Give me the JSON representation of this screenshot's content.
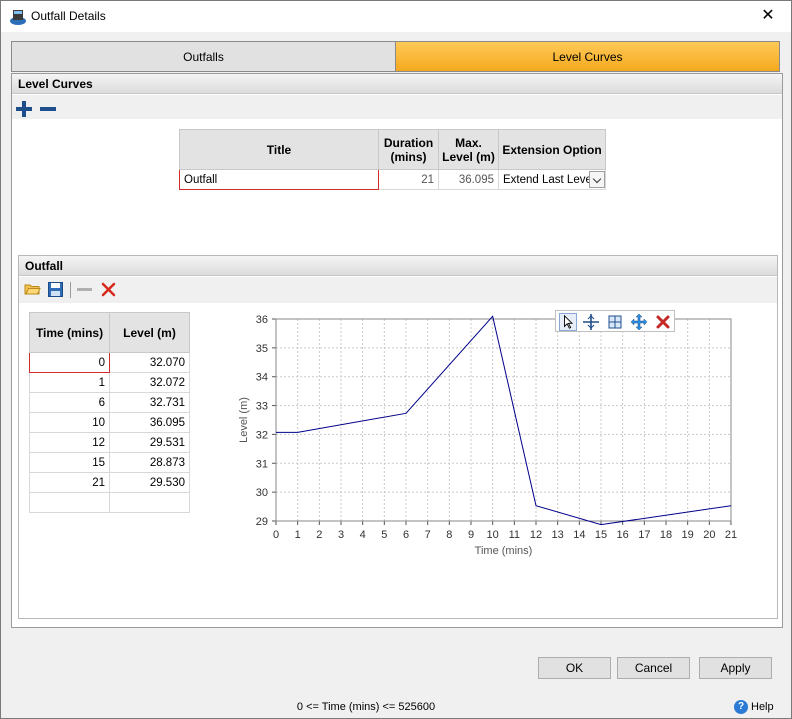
{
  "window": {
    "title": "Outfall Details",
    "close_glyph": "✕"
  },
  "tabs": [
    {
      "label": "Outfalls",
      "active": false
    },
    {
      "label": "Level Curves",
      "active": true,
      "accent": "#f4a91f"
    }
  ],
  "level_curves": {
    "header": "Level Curves",
    "columns": [
      "Title",
      "Duration (mins)",
      "Max. Level (m)",
      "Extension Option"
    ],
    "rows": [
      {
        "title": "Outfall",
        "duration": "21",
        "max_level": "36.095",
        "extension": "Extend Last Level"
      }
    ]
  },
  "outfall": {
    "header": "Outfall",
    "columns": [
      "Time (mins)",
      "Level (m)"
    ],
    "points": [
      {
        "time": "0",
        "level": "32.070"
      },
      {
        "time": "1",
        "level": "32.072"
      },
      {
        "time": "6",
        "level": "32.731"
      },
      {
        "time": "10",
        "level": "36.095"
      },
      {
        "time": "12",
        "level": "29.531"
      },
      {
        "time": "15",
        "level": "28.873"
      },
      {
        "time": "21",
        "level": "29.530"
      }
    ]
  },
  "chart_data": {
    "type": "line",
    "xlabel": "Time (mins)",
    "ylabel": "Level (m)",
    "x": [
      0,
      1,
      6,
      10,
      12,
      15,
      21
    ],
    "series": [
      {
        "values": [
          32.07,
          32.072,
          32.731,
          36.095,
          29.531,
          28.873,
          29.53
        ],
        "color": "#00008b"
      }
    ],
    "xlim": [
      0,
      21
    ],
    "ylim": [
      29,
      36
    ],
    "xticks": [
      "0",
      "1",
      "2",
      "3",
      "4",
      "5",
      "6",
      "7",
      "8",
      "9",
      "10",
      "11",
      "12",
      "13",
      "14",
      "15",
      "16",
      "17",
      "18",
      "19",
      "20",
      "21"
    ],
    "yticks": [
      "29",
      "30",
      "31",
      "32",
      "33",
      "34",
      "35",
      "36"
    ],
    "grid": true
  },
  "buttons": {
    "ok": "OK",
    "cancel": "Cancel",
    "apply": "Apply"
  },
  "status_text": "0 <= Time (mins) <= 525600",
  "help_label": "Help"
}
